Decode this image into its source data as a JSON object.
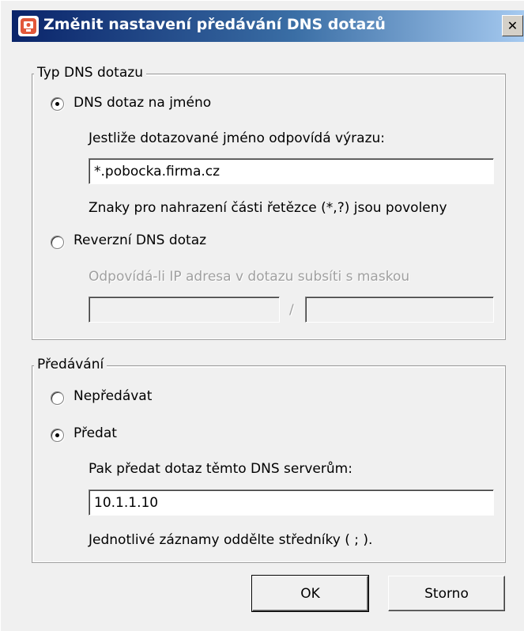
{
  "window": {
    "title": "Změnit nastavení předávání DNS dotazů",
    "close_symbol": "✕",
    "icon": "app-icon"
  },
  "query_type": {
    "legend": "Typ DNS dotazu",
    "name_query": {
      "label": "DNS dotaz na jméno",
      "checked": true,
      "match_label": "Jestliže dotazované jméno odpovídá výrazu:",
      "value": "*.pobocka.firma.cz",
      "hint": "Znaky pro nahrazení části řetězce (*,?) jsou povoleny"
    },
    "reverse_query": {
      "label": "Reverzní DNS dotaz",
      "checked": false,
      "subnet_label": "Odpovídá-li IP adresa v dotazu subsíti s maskou",
      "ip_value": "",
      "separator": "/",
      "mask_value": ""
    }
  },
  "forwarding": {
    "legend": "Předávání",
    "no_forward": {
      "label": "Nepředávat",
      "checked": false
    },
    "forward": {
      "label": "Předat",
      "checked": true,
      "servers_label": "Pak předat dotaz těmto DNS serverům:",
      "servers_value": "10.1.1.10",
      "hint": "Jednotlivé záznamy oddělte středníky ( ; )."
    }
  },
  "buttons": {
    "ok": "OK",
    "cancel": "Storno"
  }
}
